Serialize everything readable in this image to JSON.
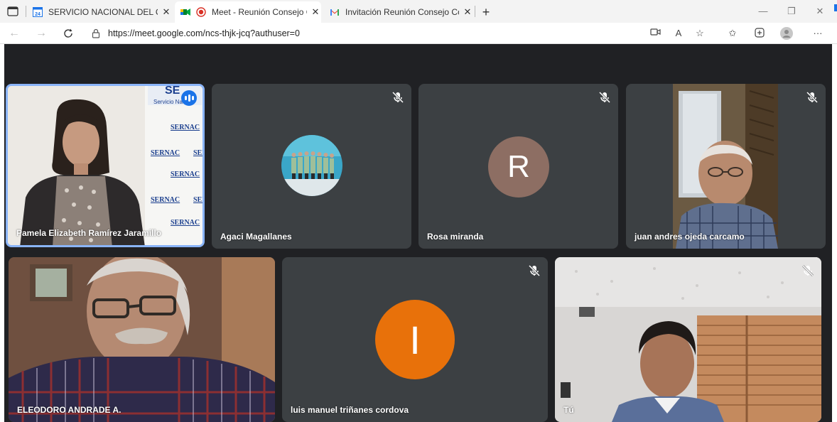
{
  "browser": {
    "tabs": [
      {
        "title": "SERVICIO NACIONAL DEL CONSU",
        "icon": "calendar-icon",
        "active": false
      },
      {
        "title": "Meet - Reunión Consejo Co",
        "icon": "meet-icon",
        "recording": true,
        "active": true
      },
      {
        "title": "Invitación Reunión Consejo Cons",
        "icon": "gmail-icon",
        "active": false
      }
    ],
    "new_tab_label": "+",
    "address_url": "https://meet.google.com/ncs-thjk-jcq?authuser=0",
    "zoom_label": "A",
    "more_label": "···"
  },
  "meeting": {
    "participants": [
      {
        "name": "Pamela Elizabeth Ramírez Jaramillo",
        "type": "video",
        "speaking": true,
        "muted": false
      },
      {
        "name": "Agaci Magallanes",
        "type": "photo-avatar",
        "muted": true
      },
      {
        "name": "Rosa miranda",
        "type": "letter-avatar",
        "initial": "R",
        "avatar_color": "#8d6e63",
        "muted": true
      },
      {
        "name": "juan andres ojeda carcamo",
        "type": "video",
        "muted": true
      },
      {
        "name": "ELEODORO ANDRADE A.",
        "type": "video",
        "muted": false
      },
      {
        "name": "luis manuel triñanes cordova",
        "type": "letter-avatar",
        "initial": "I",
        "avatar_color": "#e8710a",
        "muted": true
      },
      {
        "name": "Tú",
        "type": "video",
        "muted": true
      }
    ],
    "sernac_sign_text": "SERNAC",
    "accent": "#1a73e8"
  }
}
